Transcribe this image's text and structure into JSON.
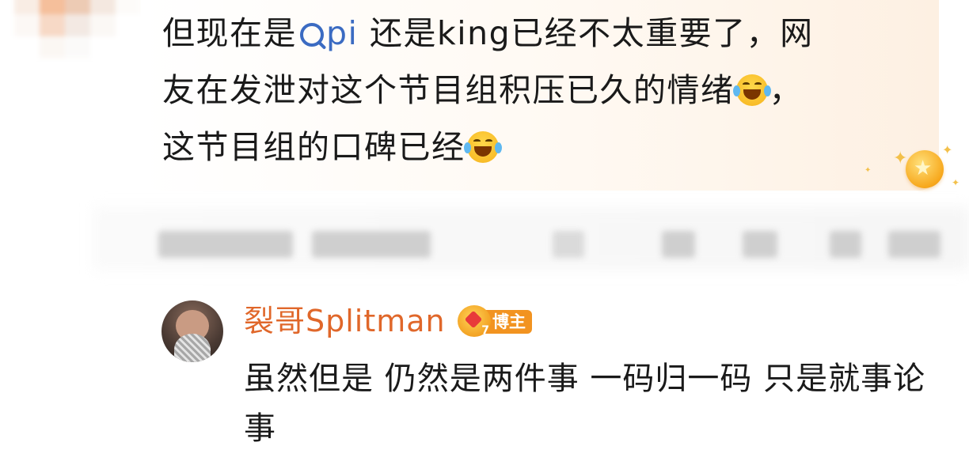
{
  "comment": {
    "line1_before": "但现在是",
    "mention": "pi",
    "line1_after": " 还是king已经不太重要了，网",
    "line2": "友在发泄对这个节目组积压已久的情绪",
    "line2_end": "，",
    "line3": "这节目组的口碑已经",
    "emoji_name": "laugh-cry-emoji"
  },
  "reply": {
    "author": "裂哥Splitman",
    "role_badge": "博主",
    "vip_level": "7",
    "text": "虽然但是 仍然是两件事 一码归一码 只是就事论事"
  },
  "colors": {
    "mention": "#3b6bc2",
    "author": "#e0672a",
    "badge": "#f29320"
  }
}
